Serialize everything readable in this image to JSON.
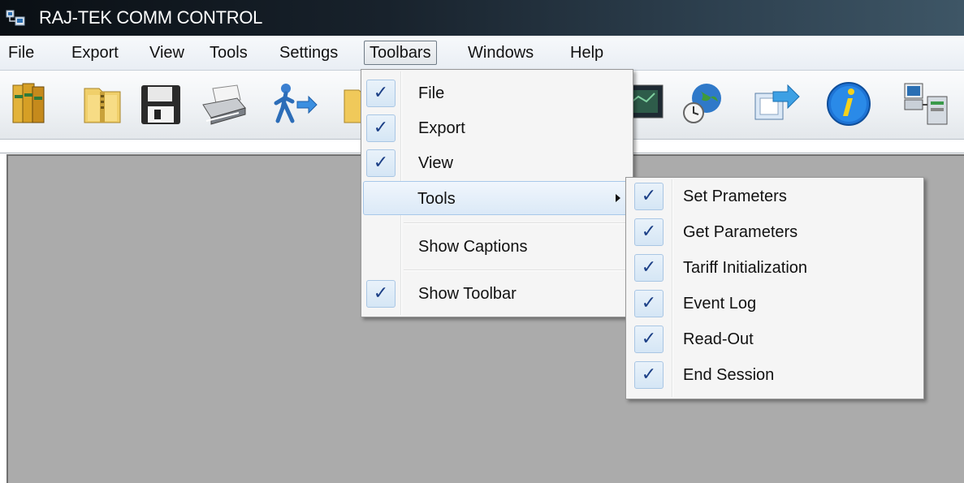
{
  "window": {
    "title": "RAJ-TEK COMM CONTROL"
  },
  "menubar": {
    "items": [
      {
        "label": "File"
      },
      {
        "label": "Export"
      },
      {
        "label": "View"
      },
      {
        "label": "Tools"
      },
      {
        "label": "Settings"
      },
      {
        "label": "Toolbars"
      },
      {
        "label": "Windows"
      },
      {
        "label": "Help"
      }
    ],
    "open_item": "Toolbars"
  },
  "toolbar": {
    "buttons": [
      {
        "icon": "books-icon"
      },
      {
        "icon": "folder-zip-icon"
      },
      {
        "icon": "floppy-disk-icon"
      },
      {
        "icon": "printer-icon"
      },
      {
        "icon": "exit-person-icon"
      },
      {
        "icon": "folder-icon"
      },
      {
        "icon": "monitor-icon"
      },
      {
        "icon": "globe-clock-icon"
      },
      {
        "icon": "transfer-icon"
      },
      {
        "icon": "info-icon"
      },
      {
        "icon": "network-computer-icon"
      }
    ]
  },
  "toolbars_menu": {
    "items": [
      {
        "label": "File",
        "checked": true
      },
      {
        "label": "Export",
        "checked": true
      },
      {
        "label": "View",
        "checked": true
      },
      {
        "label": "Tools",
        "checked": false,
        "has_submenu": true,
        "highlighted": true
      },
      {
        "label": "Show Captions",
        "checked": false
      },
      {
        "label": "Show Toolbar",
        "checked": true
      }
    ],
    "check_glyph": "✓"
  },
  "tools_submenu": {
    "items": [
      {
        "label": "Set Prameters",
        "checked": true
      },
      {
        "label": "Get Parameters",
        "checked": true
      },
      {
        "label": "Tariff Initialization",
        "checked": true
      },
      {
        "label": "Event Log",
        "checked": true
      },
      {
        "label": "Read-Out",
        "checked": true
      },
      {
        "label": "End Session",
        "checked": true
      }
    ]
  },
  "colors": {
    "title_bar": "#0a0f14",
    "client_area": "#ababab",
    "check_blue": "#1b3f86",
    "highlight_border": "#a8c8ea"
  }
}
